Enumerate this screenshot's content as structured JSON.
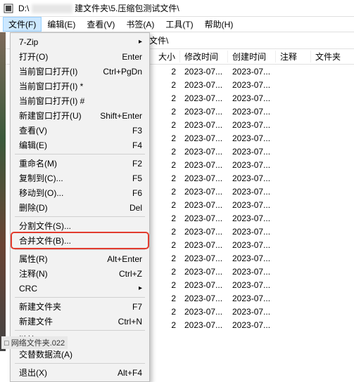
{
  "window": {
    "icon": "7z-icon",
    "path_prefix": "D:\\",
    "path_suffix": "建文件夹\\5.压缩包测试文件\\"
  },
  "menubar": {
    "items": [
      {
        "label": "文件(F)",
        "active": true
      },
      {
        "label": "编辑(E)",
        "active": false
      },
      {
        "label": "查看(V)",
        "active": false
      },
      {
        "label": "书签(A)",
        "active": false
      },
      {
        "label": "工具(T)",
        "active": false
      },
      {
        "label": "帮助(H)",
        "active": false
      }
    ]
  },
  "dropdown": {
    "items": [
      {
        "label": "7-Zip",
        "sub": true
      },
      {
        "label": "打开(O)",
        "shortcut": "Enter"
      },
      {
        "label": "当前窗口打开(I)",
        "shortcut": "Ctrl+PgDn"
      },
      {
        "label": "当前窗口打开(I) *"
      },
      {
        "label": "当前窗口打开(I) #"
      },
      {
        "label": "新建窗口打开(U)",
        "shortcut": "Shift+Enter"
      },
      {
        "label": "查看(V)",
        "shortcut": "F3"
      },
      {
        "label": "编辑(E)",
        "shortcut": "F4"
      },
      {
        "sep": true
      },
      {
        "label": "重命名(M)",
        "shortcut": "F2"
      },
      {
        "label": "复制到(C)...",
        "shortcut": "F5"
      },
      {
        "label": "移动到(O)...",
        "shortcut": "F6"
      },
      {
        "label": "删除(D)",
        "shortcut": "Del"
      },
      {
        "sep": true
      },
      {
        "label": "分割文件(S)..."
      },
      {
        "label": "合并文件(B)...",
        "highlight": true
      },
      {
        "sep": true
      },
      {
        "label": "属性(R)",
        "shortcut": "Alt+Enter"
      },
      {
        "label": "注释(N)",
        "shortcut": "Ctrl+Z"
      },
      {
        "label": "CRC",
        "sub": true
      },
      {
        "sep": true
      },
      {
        "label": "新建文件夹",
        "shortcut": "F7"
      },
      {
        "label": "新建文件",
        "shortcut": "Ctrl+N"
      },
      {
        "sep": true
      },
      {
        "label": "链接"
      },
      {
        "label": "交替数据流(A)"
      },
      {
        "sep": true
      },
      {
        "label": "退出(X)",
        "shortcut": "Alt+F4"
      }
    ]
  },
  "listing": {
    "path_tail": "试文件\\",
    "columns": {
      "size": "大小",
      "mod": "修改时间",
      "create": "创建时间",
      "comment": "注释",
      "folder": "文件夹"
    },
    "rows": [
      {
        "size": "2",
        "mod": "2023-07...",
        "create": "2023-07..."
      },
      {
        "size": "2",
        "mod": "2023-07...",
        "create": "2023-07..."
      },
      {
        "size": "2",
        "mod": "2023-07...",
        "create": "2023-07..."
      },
      {
        "size": "2",
        "mod": "2023-07...",
        "create": "2023-07..."
      },
      {
        "size": "2",
        "mod": "2023-07...",
        "create": "2023-07..."
      },
      {
        "size": "2",
        "mod": "2023-07...",
        "create": "2023-07..."
      },
      {
        "size": "2",
        "mod": "2023-07...",
        "create": "2023-07..."
      },
      {
        "size": "2",
        "mod": "2023-07...",
        "create": "2023-07..."
      },
      {
        "size": "2",
        "mod": "2023-07...",
        "create": "2023-07..."
      },
      {
        "size": "2",
        "mod": "2023-07...",
        "create": "2023-07..."
      },
      {
        "size": "2",
        "mod": "2023-07...",
        "create": "2023-07..."
      },
      {
        "size": "2",
        "mod": "2023-07...",
        "create": "2023-07..."
      },
      {
        "size": "2",
        "mod": "2023-07...",
        "create": "2023-07..."
      },
      {
        "size": "2",
        "mod": "2023-07...",
        "create": "2023-07..."
      },
      {
        "size": "2",
        "mod": "2023-07...",
        "create": "2023-07..."
      },
      {
        "size": "2",
        "mod": "2023-07...",
        "create": "2023-07..."
      },
      {
        "size": "2",
        "mod": "2023-07...",
        "create": "2023-07..."
      },
      {
        "size": "2",
        "mod": "2023-07...",
        "create": "2023-07..."
      },
      {
        "size": "2",
        "mod": "2023-07...",
        "create": "2023-07..."
      },
      {
        "size": "2",
        "mod": "2023-07...",
        "create": "2023-07..."
      }
    ]
  },
  "footer": {
    "thumb": "□ 网络文件夹.022"
  }
}
